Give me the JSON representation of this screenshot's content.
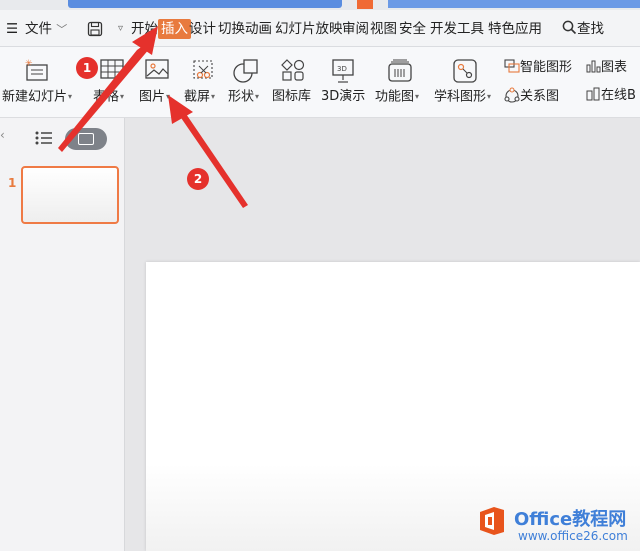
{
  "menubar": {
    "file_label": "文件",
    "items": [
      "开始",
      "插入",
      "设计",
      "切换",
      "动画",
      "幻灯片放映",
      "审阅",
      "视图",
      "安全",
      "开发工具",
      "特色应用"
    ],
    "search_label": "查找"
  },
  "ribbon": {
    "new_slide": "新建幻灯片",
    "table": "表格",
    "picture": "图片",
    "screenshot": "截屏",
    "shape": "形状",
    "icon_lib": "图标库",
    "demo3d": "3D演示",
    "func_chart": "功能图",
    "subject_chart": "学科图形",
    "smart_shape": "智能图形",
    "chart": "图表",
    "relation": "关系图",
    "online": "在线B"
  },
  "slides_panel": {
    "slide_number": "1"
  },
  "annotations": {
    "badge1": "1",
    "badge2": "2"
  },
  "watermark": {
    "brand": "Office教程网",
    "url": "www.office26.com"
  },
  "colors": {
    "accent_orange": "#e87a3e",
    "badge_red": "#e5312c",
    "arrow_red": "#e5312c"
  }
}
